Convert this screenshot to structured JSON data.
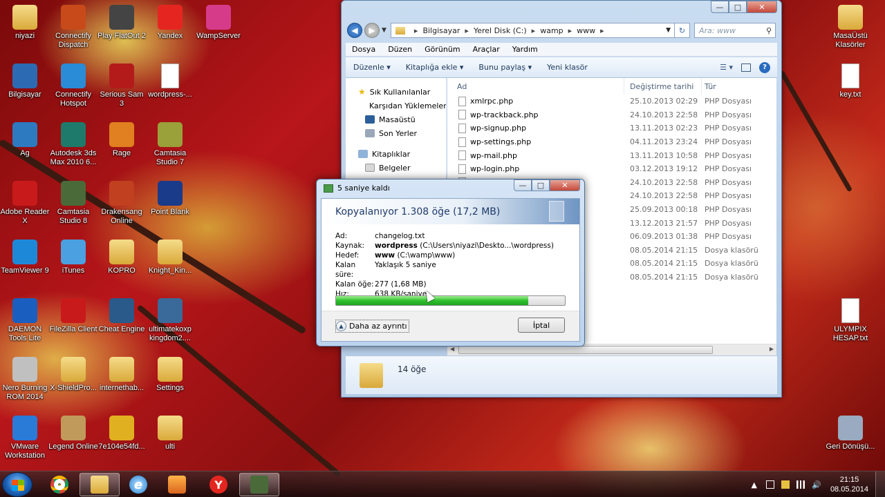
{
  "desktop": {
    "icons": [
      {
        "label": "niyazi"
      },
      {
        "label": "Connectify Dispatch"
      },
      {
        "label": "Play FlatOut 2"
      },
      {
        "label": "Yandex"
      },
      {
        "label": "WampServer"
      },
      {
        "label": "Bilgisayar"
      },
      {
        "label": "Connectify Hotspot"
      },
      {
        "label": "Serious Sam 3"
      },
      {
        "label": "wordpress-..."
      },
      {
        "label": "Ag"
      },
      {
        "label": "Autodesk 3ds Max 2010 6..."
      },
      {
        "label": "Rage"
      },
      {
        "label": "Camtasia Studio 7"
      },
      {
        "label": "Adobe Reader X"
      },
      {
        "label": "Camtasia Studio 8"
      },
      {
        "label": "Drakensang Online"
      },
      {
        "label": "Point Blank"
      },
      {
        "label": "TeamViewer 9"
      },
      {
        "label": "iTunes"
      },
      {
        "label": "KOPRO"
      },
      {
        "label": "Knight_Kin..."
      },
      {
        "label": "DAEMON Tools Lite"
      },
      {
        "label": "FileZilla Client"
      },
      {
        "label": "Cheat Engine"
      },
      {
        "label": "ultimatekoxp kingdom2...."
      },
      {
        "label": "Nero Burning ROM 2014"
      },
      {
        "label": "X-ShieldPro..."
      },
      {
        "label": "internethab..."
      },
      {
        "label": "Settings"
      },
      {
        "label": "VMware Workstation"
      },
      {
        "label": "Legend Online"
      },
      {
        "label": "7e104e54fd..."
      },
      {
        "label": "ulti"
      },
      {
        "label": "MasaÜstü Klasörler"
      },
      {
        "label": "key.txt"
      },
      {
        "label": "ULYMPIX HESAP.txt"
      },
      {
        "label": "Geri Dönüşü..."
      }
    ]
  },
  "explorer": {
    "address": [
      "Bilgisayar",
      "Yerel Disk (C:)",
      "wamp",
      "www"
    ],
    "search_placeholder": "Ara: www",
    "menu": [
      "Dosya",
      "Düzen",
      "Görünüm",
      "Araçlar",
      "Yardım"
    ],
    "commands": [
      "Düzenle ▾",
      "Kitaplığa ekle ▾",
      "Bunu paylaş ▾",
      "Yeni klasör"
    ],
    "nav": {
      "favorites": "Sık Kullanılanlar",
      "downloads": "Karşıdan Yüklemeler",
      "desktop": "Masaüstü",
      "recent": "Son Yerler",
      "libraries": "Kitaplıklar",
      "documents": "Belgeler"
    },
    "columns": {
      "name": "Ad",
      "date": "Değiştirme tarihi",
      "type": "Tür"
    },
    "files": [
      {
        "name": "xmlrpc.php",
        "date": "25.10.2013 02:29",
        "type": "PHP Dosyası"
      },
      {
        "name": "wp-trackback.php",
        "date": "24.10.2013 22:58",
        "type": "PHP Dosyası"
      },
      {
        "name": "wp-signup.php",
        "date": "13.11.2013 02:23",
        "type": "PHP Dosyası"
      },
      {
        "name": "wp-settings.php",
        "date": "04.11.2013 23:24",
        "type": "PHP Dosyası"
      },
      {
        "name": "wp-mail.php",
        "date": "13.11.2013 10:58",
        "type": "PHP Dosyası"
      },
      {
        "name": "wp-login.php",
        "date": "03.12.2013 19:12",
        "type": "PHP Dosyası"
      },
      {
        "name": "",
        "date": "24.10.2013 22:58",
        "type": "PHP Dosyası"
      },
      {
        "name": "",
        "date": "24.10.2013 22:58",
        "type": "PHP Dosyası"
      },
      {
        "name": "",
        "date": "25.09.2013 00:18",
        "type": "PHP Dosyası"
      },
      {
        "name": "",
        "date": "13.12.2013 21:57",
        "type": "PHP Dosyası"
      },
      {
        "name": "",
        "date": "06.09.2013 01:38",
        "type": "PHP Dosyası"
      },
      {
        "name": "",
        "date": "08.05.2014 21:15",
        "type": "Dosya klasörü"
      },
      {
        "name": "",
        "date": "08.05.2014 21:15",
        "type": "Dosya klasörü"
      },
      {
        "name": "",
        "date": "08.05.2014 21:15",
        "type": "Dosya klasörü"
      }
    ],
    "item_count": "14 öğe"
  },
  "copy_dialog": {
    "title": "5 saniye kaldı",
    "heading": "Kopyalanıyor 1.308 öğe (17,2 MB)",
    "rows": [
      {
        "key": "Ad:",
        "bold": "",
        "value": "changelog.txt"
      },
      {
        "key": "Kaynak:",
        "bold": "wordpress",
        "value": " (C:\\Users\\niyazi\\Deskto...\\wordpress)"
      },
      {
        "key": "Hedef:",
        "bold": "www",
        "value": " (C:\\wamp\\www)"
      },
      {
        "key": "Kalan süre:",
        "bold": "",
        "value": "Yaklaşık 5 saniye"
      },
      {
        "key": "Kalan öğe:",
        "bold": "",
        "value": "277 (1,68 MB)"
      },
      {
        "key": "Hız:",
        "bold": "",
        "value": "638 KB/saniye"
      }
    ],
    "progress": 0.84,
    "less_details": "Daha az ayrıntı",
    "cancel": "İptal"
  },
  "taskbar": {
    "time": "21:15",
    "date": "08.05.2014"
  }
}
